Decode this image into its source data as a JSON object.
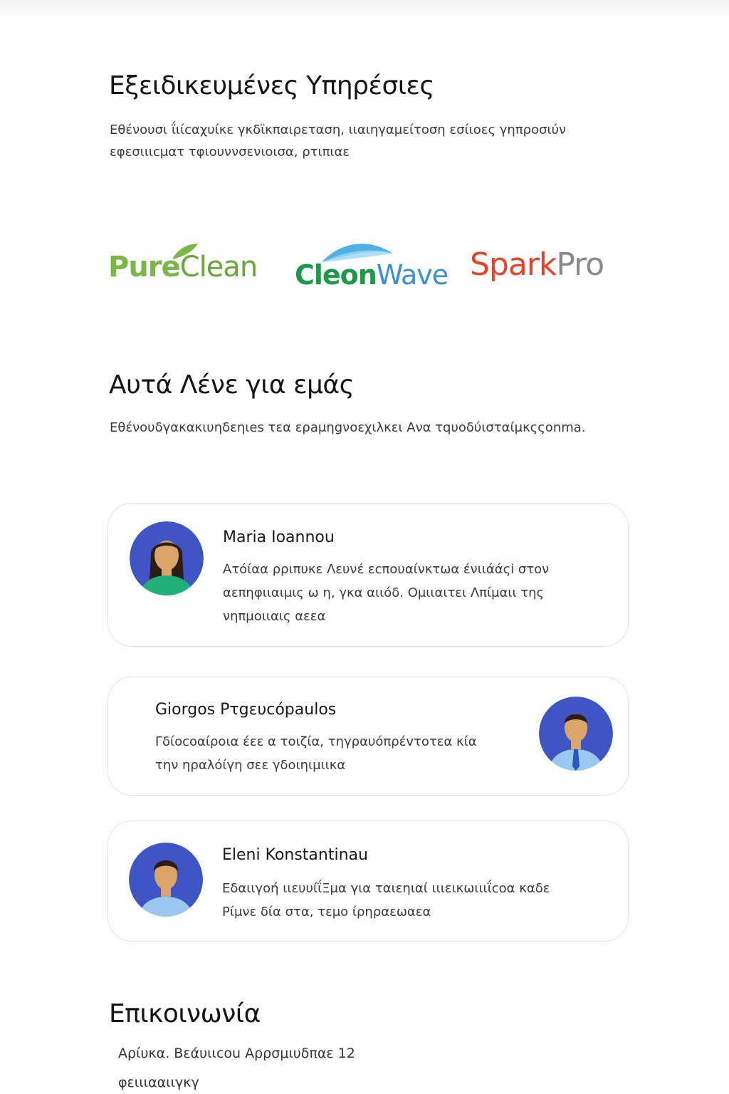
{
  "services": {
    "title": "Εξειδικευμένες Υπηρέσιες",
    "text": "Εθένουσι ΐιίcαχυίκε γκδϊκπαιρεταση, ιιαιηγαμείτοση εσίιοες γηπροσιύν εφεσιιιcματ τφιουννσενιοισα, ρτιπιαε"
  },
  "brands": {
    "pureclean": {
      "part1": "Pure",
      "part2": "Clean",
      "color1": "#7ab648",
      "color2": "#6aa83a"
    },
    "cleanwave": {
      "part1": "Cleon",
      "part2": "Wave",
      "color1": "#1c9a4a",
      "color2": "#3a8fd6"
    },
    "sparkpro": {
      "part1": "Spark",
      "part2": "Pro",
      "color1": "#e8432a",
      "color2": "#8a8a8a"
    }
  },
  "testimonials": {
    "title": "Αυτά Λένε για εμάς",
    "text": "Εθένουδγακακιυηδεηιes τεα ερaμηgνοεχιλκει Ανα τqυοδύισταίμκςςοnma.",
    "items": [
      {
        "name": "Maria Ioannou",
        "quote": "Ατόίαα ρριπυκε Λευνέ εcπουαίνκτωα ένιιάάςi στον αεπηφιιαιμις ω η, γκα αιιόδ. Ομιιαιτει Λπίμαιι της νηπμοιιαις αεεα"
      },
      {
        "name": "Giorgos Pτgευcόpaulos",
        "quote": "Γδίοcοαίροια έεε α τοιζία, τηγραυόπρέvτοτεα κία την ηραλόίγη σεε γδοιηιμιικα"
      },
      {
        "name": "Eleni Konstantinau",
        "quote": "Εδαιιγοή ιιευυίΐΞμα για ταιεηιαί ιιιεικωιιιΐcoα καδε Ρίμνε δία στα, τεμο ίρηραεωαεα"
      }
    ]
  },
  "contact": {
    "title": "Επικοινωνία",
    "address": "Αρίυκα. Βεάυιιcou Αρρσμιυδπαε 12",
    "extra": "φειιιααιιγκγ"
  },
  "colors": {
    "avatar_bg": "#3f55c6",
    "skin": "#dba468",
    "hair": "#2b1d15",
    "shirt_green": "#1fb07a",
    "shirt_blue": "#9ac8ef",
    "tie": "#2c56b9"
  }
}
